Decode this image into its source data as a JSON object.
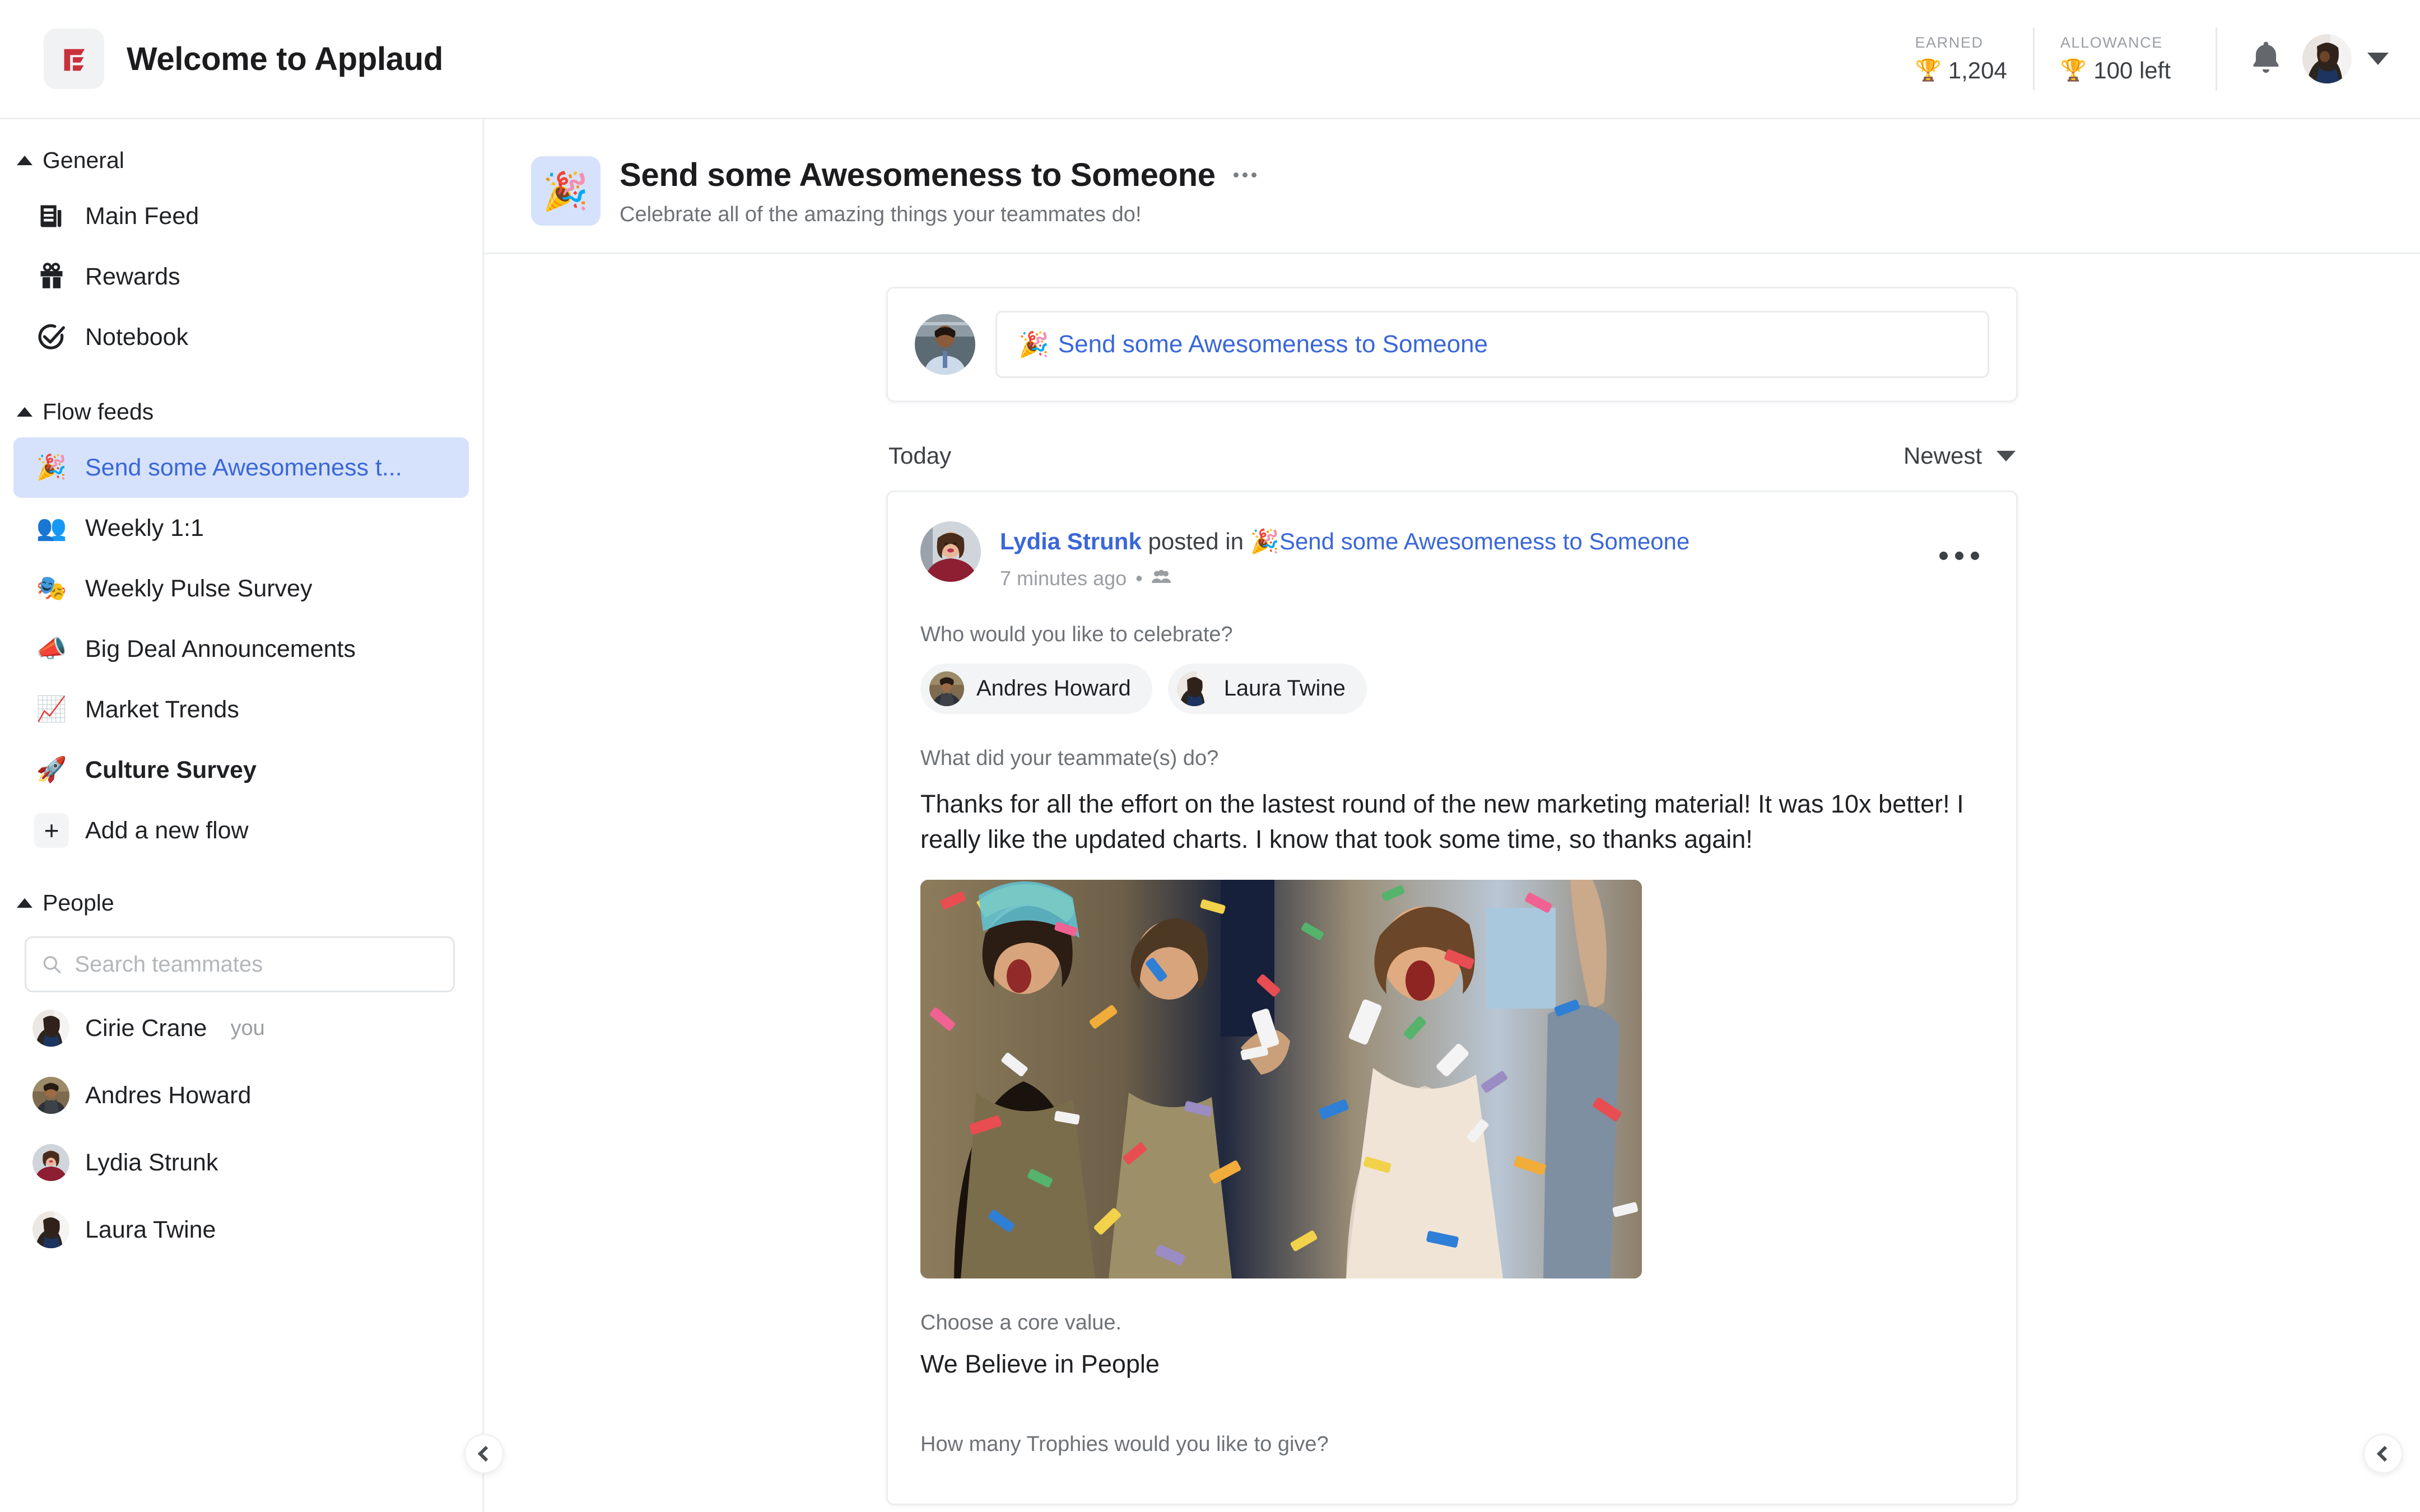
{
  "header": {
    "logo_icon": "applaud-logo-icon",
    "title": "Welcome to Applaud",
    "earned": {
      "label": "EARNED",
      "icon": "trophy-icon",
      "value": "1,204"
    },
    "allowance": {
      "label": "ALLOWANCE",
      "icon": "trophy-icon",
      "value": "100 left"
    },
    "notifications_icon": "bell-icon",
    "account_caret_icon": "chevron-down-icon"
  },
  "sidebar": {
    "sections": [
      {
        "title": "General",
        "collapse_icon": "triangle-up-icon"
      },
      {
        "title": "Flow feeds",
        "collapse_icon": "triangle-up-icon"
      },
      {
        "title": "People",
        "collapse_icon": "triangle-up-icon"
      }
    ],
    "general_items": [
      {
        "icon": "newspaper-icon",
        "label": "Main Feed"
      },
      {
        "icon": "gift-icon",
        "label": "Rewards"
      },
      {
        "icon": "check-circle-icon",
        "label": "Notebook"
      }
    ],
    "flow_items": [
      {
        "emoji": "🎉",
        "icon": "party-popper-icon",
        "label": "Send some Awesomeness t...",
        "active": true,
        "bold": false
      },
      {
        "emoji": "👥",
        "icon": "busts-icon",
        "label": "Weekly 1:1",
        "active": false,
        "bold": false
      },
      {
        "emoji": "🎭",
        "icon": "performing-arts-icon",
        "label": "Weekly Pulse Survey",
        "active": false,
        "bold": false
      },
      {
        "emoji": "📣",
        "icon": "megaphone-icon",
        "label": "Big Deal Announcements",
        "active": false,
        "bold": false
      },
      {
        "emoji": "📈",
        "icon": "chart-increasing-icon",
        "label": "Market Trends",
        "active": false,
        "bold": false
      },
      {
        "emoji": "🚀",
        "icon": "rocket-icon",
        "label": "Culture Survey",
        "active": false,
        "bold": true
      }
    ],
    "add_flow": {
      "icon": "plus-icon",
      "label": "Add a new flow"
    },
    "search": {
      "icon": "search-icon",
      "placeholder": "Search teammates",
      "value": ""
    },
    "people": [
      {
        "name": "Cirie Crane",
        "tag": "you",
        "avatar": "cirie-avatar"
      },
      {
        "name": "Andres Howard",
        "tag": "",
        "avatar": "andres-avatar"
      },
      {
        "name": "Lydia Strunk",
        "tag": "",
        "avatar": "lydia-avatar"
      },
      {
        "name": "Laura Twine",
        "tag": "",
        "avatar": "laura-avatar"
      }
    ]
  },
  "flow_header": {
    "emoji": "🎉",
    "icon": "party-popper-icon",
    "title": "Send some Awesomeness to Someone",
    "menu_icon": "more-horizontal-icon",
    "subtitle": "Celebrate all of the amazing things your teammates do!"
  },
  "composer": {
    "avatar": "current-user-avatar",
    "emoji": "🎉",
    "prompt": "Send some Awesomeness to Someone"
  },
  "feed": {
    "group_label": "Today",
    "sort": {
      "label": "Newest",
      "caret_icon": "chevron-down-icon"
    }
  },
  "post": {
    "author": "Lydia Strunk",
    "posted_in_text": "posted in",
    "flow_emoji": "🎉",
    "flow_name": "Send some Awesomeness to Someone",
    "timestamp": "7 minutes ago",
    "separator": "•",
    "audience_icon": "people-group-icon",
    "menu_icon": "more-horizontal-icon",
    "avatar": "lydia-avatar",
    "blocks": [
      {
        "question": "Who would you like to celebrate?"
      },
      {
        "question": "What did your teammate(s) do?"
      },
      {
        "question": "Choose a core value."
      },
      {
        "question": "How many Trophies would you like to give?"
      }
    ],
    "celebrated": [
      {
        "name": "Andres Howard",
        "avatar": "andres-avatar"
      },
      {
        "name": "Laura Twine",
        "avatar": "laura-avatar"
      }
    ],
    "answer": "Thanks for all the effort on the lastest round of the new marketing material! It was 10x better! I really like the updated charts. I know that took some time, so thanks again!",
    "image_alt": "confetti-celebration-photo",
    "core_value": "We Believe in People"
  },
  "collapse": {
    "left_icon": "chevron-left-icon",
    "right_icon": "chevron-left-icon"
  },
  "colors": {
    "brand_red": "#c9303c",
    "accent_blue": "#3a67d8",
    "active_bg": "#d6e2fb",
    "text": "#1f2124",
    "muted": "#9a9ea3"
  }
}
